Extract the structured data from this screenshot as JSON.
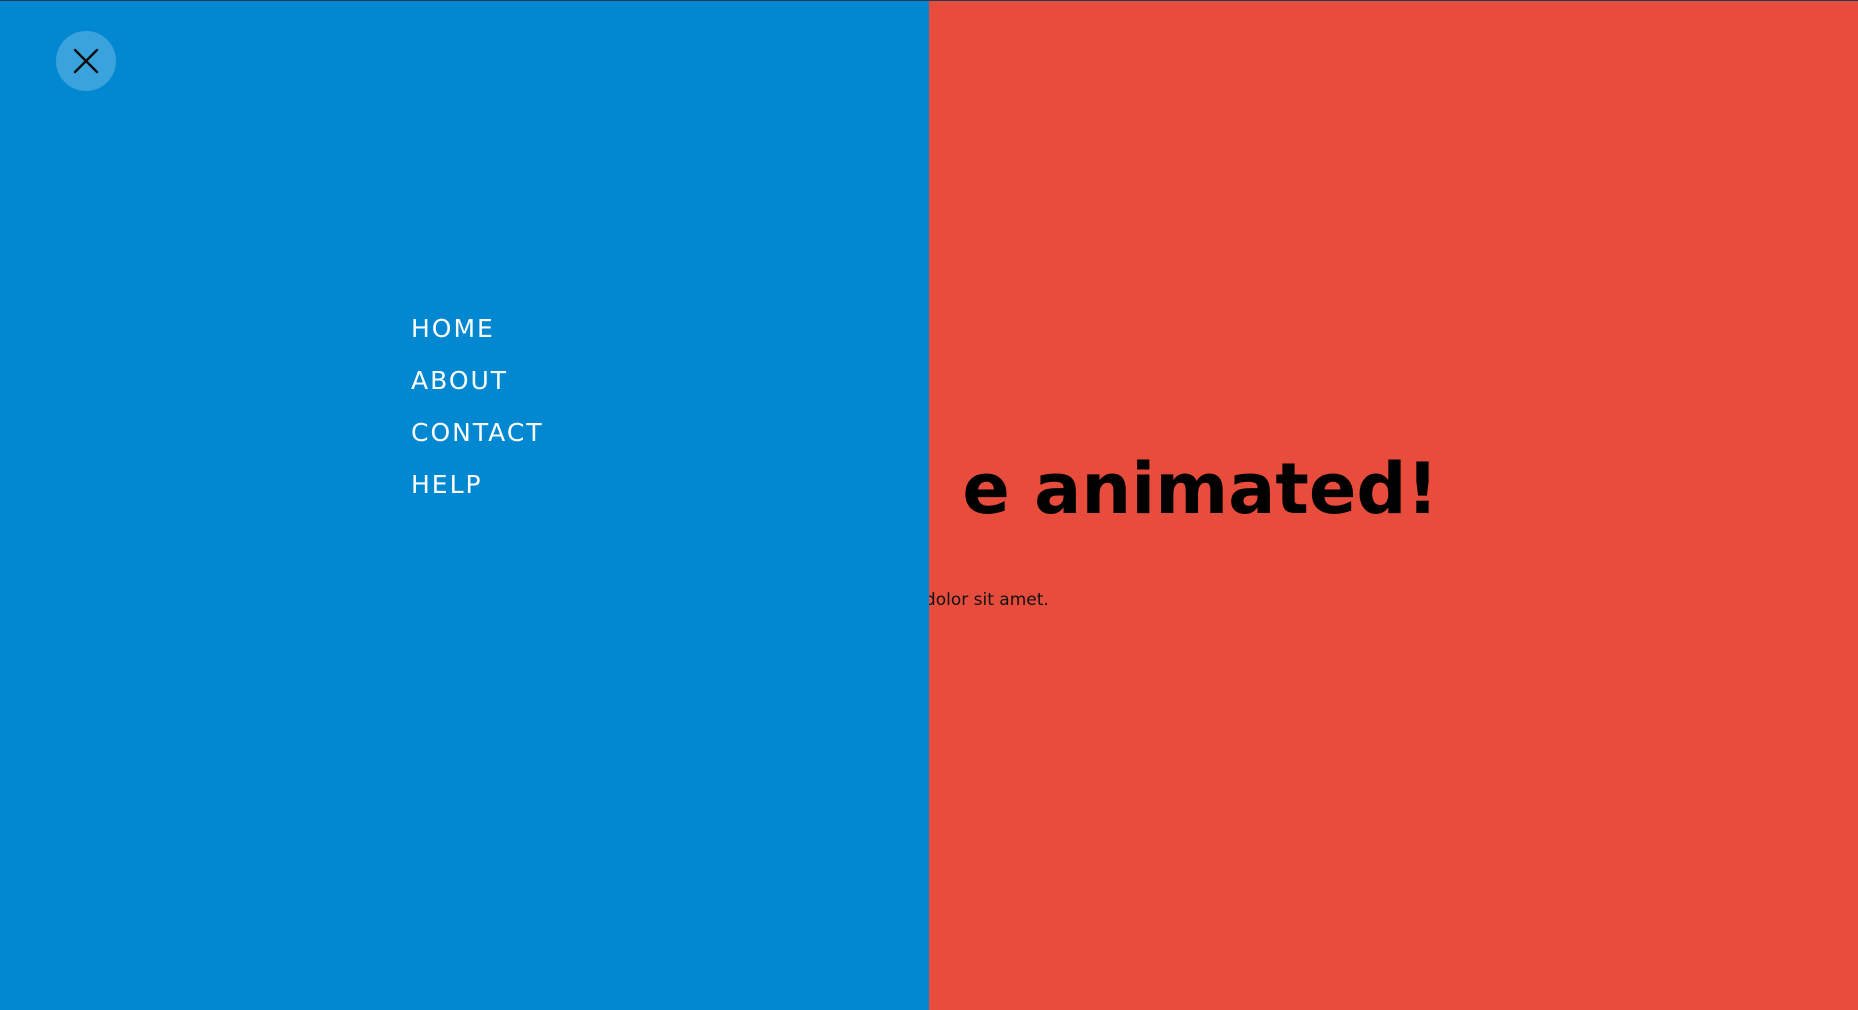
{
  "colors": {
    "menu_panel": "#0288D1",
    "page_background": "#E74C3C",
    "close_button_bg": "#3AA3DE",
    "menu_text": "#FFFFFF",
    "hero_text": "#000000"
  },
  "menu": {
    "close_icon": "close-icon",
    "items": [
      {
        "label": "HOME"
      },
      {
        "label": "ABOUT"
      },
      {
        "label": "CONTACT"
      },
      {
        "label": "HELP"
      }
    ]
  },
  "hero": {
    "title_visible": "e animated!",
    "text_visible": "dolor sit amet."
  }
}
